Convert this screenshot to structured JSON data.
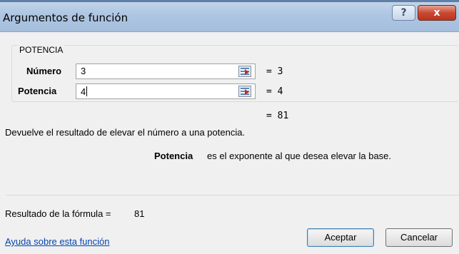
{
  "window": {
    "title": "Argumentos de función",
    "help_glyph": "?",
    "close_glyph": "x"
  },
  "function": {
    "name": "POTENCIA",
    "args": [
      {
        "label": "Número",
        "value": "3",
        "result": "=  3"
      },
      {
        "label": "Potencia",
        "value": "4",
        "result": "=  4"
      }
    ],
    "overall_result": "=  81",
    "description": "Devuelve el resultado de elevar el número a una potencia.",
    "arg_help_name": "Potencia",
    "arg_help_text": "es el exponente al que desea elevar la base."
  },
  "footer": {
    "formula_result_label": "Resultado de la fórmula =",
    "formula_result_value": "81",
    "help_link": "Ayuda sobre esta función",
    "ok_label": "Aceptar",
    "cancel_label": "Cancelar"
  },
  "colors": {
    "title_gradient": "#aec6e2",
    "link": "#0645ad",
    "close_button": "#c94a33"
  },
  "icons": {
    "help": "question-icon",
    "close": "close-icon",
    "collapse": "collapse-dialog-icon"
  }
}
